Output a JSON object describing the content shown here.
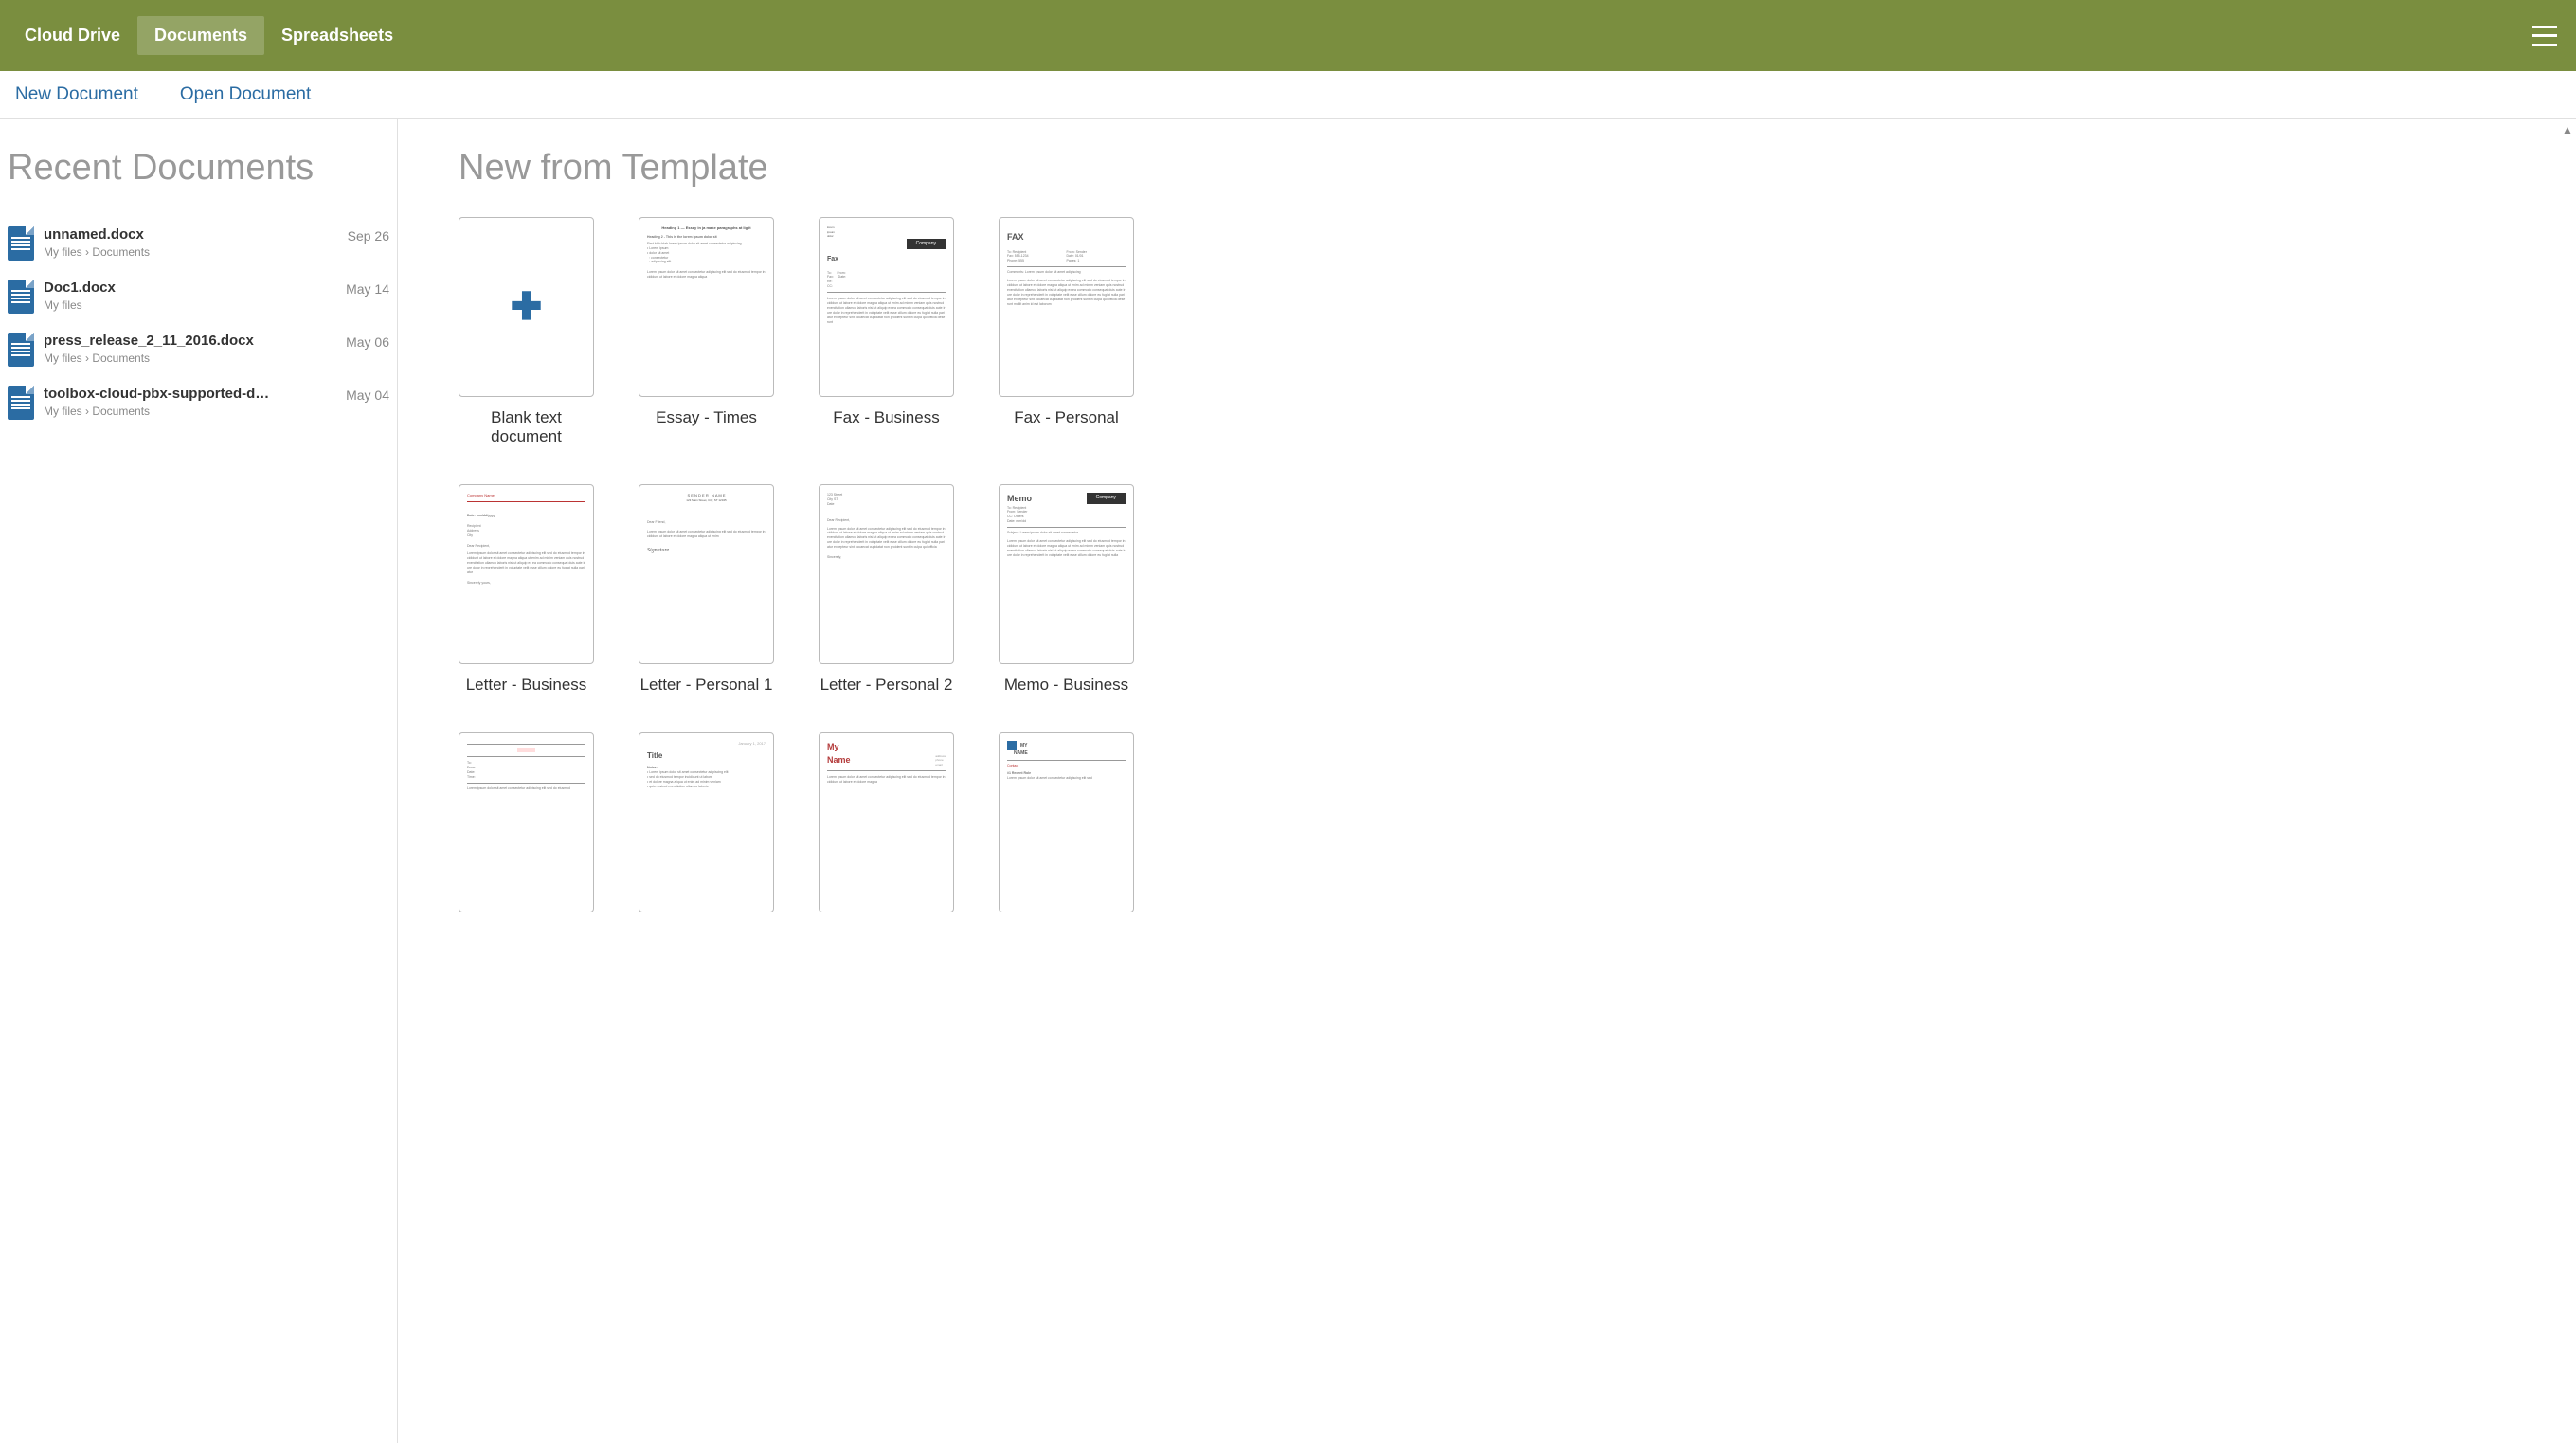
{
  "header": {
    "tabs": [
      {
        "label": "Cloud Drive",
        "active": false
      },
      {
        "label": "Documents",
        "active": true
      },
      {
        "label": "Spreadsheets",
        "active": false
      }
    ]
  },
  "actions": {
    "new_document": "New Document",
    "open_document": "Open Document"
  },
  "sidebar": {
    "title": "Recent Documents",
    "items": [
      {
        "name": "unnamed.docx",
        "path": "My files › Documents",
        "date": "Sep 26"
      },
      {
        "name": "Doc1.docx",
        "path": "My files",
        "date": "May 14"
      },
      {
        "name": "press_release_2_11_2016.docx",
        "path": "My files › Documents",
        "date": "May 06"
      },
      {
        "name": "toolbox-cloud-pbx-supported-d…",
        "path": "My files › Documents",
        "date": "May 04"
      }
    ]
  },
  "main": {
    "title": "New from Template",
    "templates": [
      {
        "label": "Blank text document",
        "type": "blank"
      },
      {
        "label": "Essay - Times",
        "type": "essay"
      },
      {
        "label": "Fax - Business",
        "type": "fax-business"
      },
      {
        "label": "Fax - Personal",
        "type": "fax-personal"
      },
      {
        "label": "Letter - Business",
        "type": "letter-business"
      },
      {
        "label": "Letter - Personal 1",
        "type": "letter-personal-1"
      },
      {
        "label": "Letter - Personal 2",
        "type": "letter-personal-2"
      },
      {
        "label": "Memo - Business",
        "type": "memo-business"
      },
      {
        "label": "",
        "type": "generic-1"
      },
      {
        "label": "",
        "type": "title-doc"
      },
      {
        "label": "",
        "type": "my-name"
      },
      {
        "label": "",
        "type": "my-name-blue"
      }
    ]
  }
}
